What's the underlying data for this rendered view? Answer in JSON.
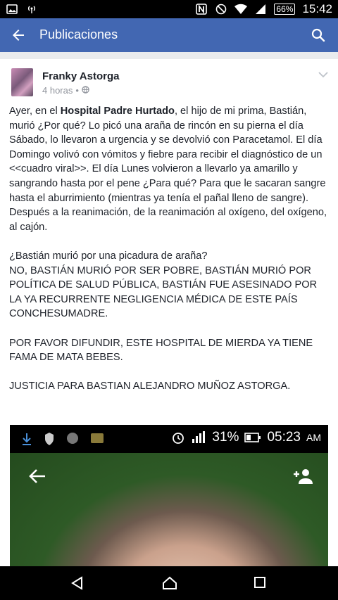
{
  "status_bar": {
    "battery": "66%",
    "time": "15:42"
  },
  "app_bar": {
    "title": "Publicaciones"
  },
  "post": {
    "author": "Franky Astorga",
    "time_ago": "4 horas",
    "separator": "•",
    "paragraphs": [
      {
        "before": "Ayer, en el ",
        "bold": "Hospital Padre Hurtado",
        "after": ", el hijo de mi prima, Bastián, murió ¿Por qué? Lo picó una araña de rincón en su pierna el día Sábado, lo llevaron a urgencia y se devolvió con Paracetamol. El día Domingo volivó con vómitos y fiebre para recibir el diagnóstico de un <<cuadro viral>>. El día Lunes volvieron a llevarlo ya amarillo y sangrando hasta por el pene ¿Para qué? Para que le sacaran sangre hasta el aburrimiento (mientras ya tenía el pañal lleno de sangre). Después a la reanimación, de la reanimación al oxígeno, del oxígeno, al cajón."
      },
      {
        "text": "¿Bastián murió por una picadura de araña?\nNO, BASTIÁN MURIÓ POR SER POBRE, BASTIÁN MURIÓ POR POLÍTICA DE SALUD PÚBLICA, BASTIÁN FUE ASESINADO POR LA YA RECURRENTE NEGLIGENCIA MÉDICA DE ESTE PAÍS CONCHESUMADRE."
      },
      {
        "text": "POR FAVOR DIFUNDIR, ESTE HOSPITAL DE MIERDA YA TIENE FAMA DE MATA BEBES."
      },
      {
        "text": "JUSTICIA PARA BASTIAN ALEJANDRO MUÑOZ ASTORGA."
      }
    ],
    "photo": {
      "battery": "31%",
      "time": "05:23",
      "ampm": "AM"
    }
  },
  "colors": {
    "brand_blue": "#4267b2",
    "page_bg": "#e9ebee"
  },
  "icons": [
    "nfc-icon",
    "hotspot-icon",
    "n-icon",
    "do-not-disturb-icon",
    "wifi-icon",
    "signal-icon",
    "back-arrow-icon",
    "search-icon",
    "globe-icon",
    "chevron-down-icon",
    "nav-back-icon",
    "nav-home-icon",
    "nav-recents-icon"
  ]
}
